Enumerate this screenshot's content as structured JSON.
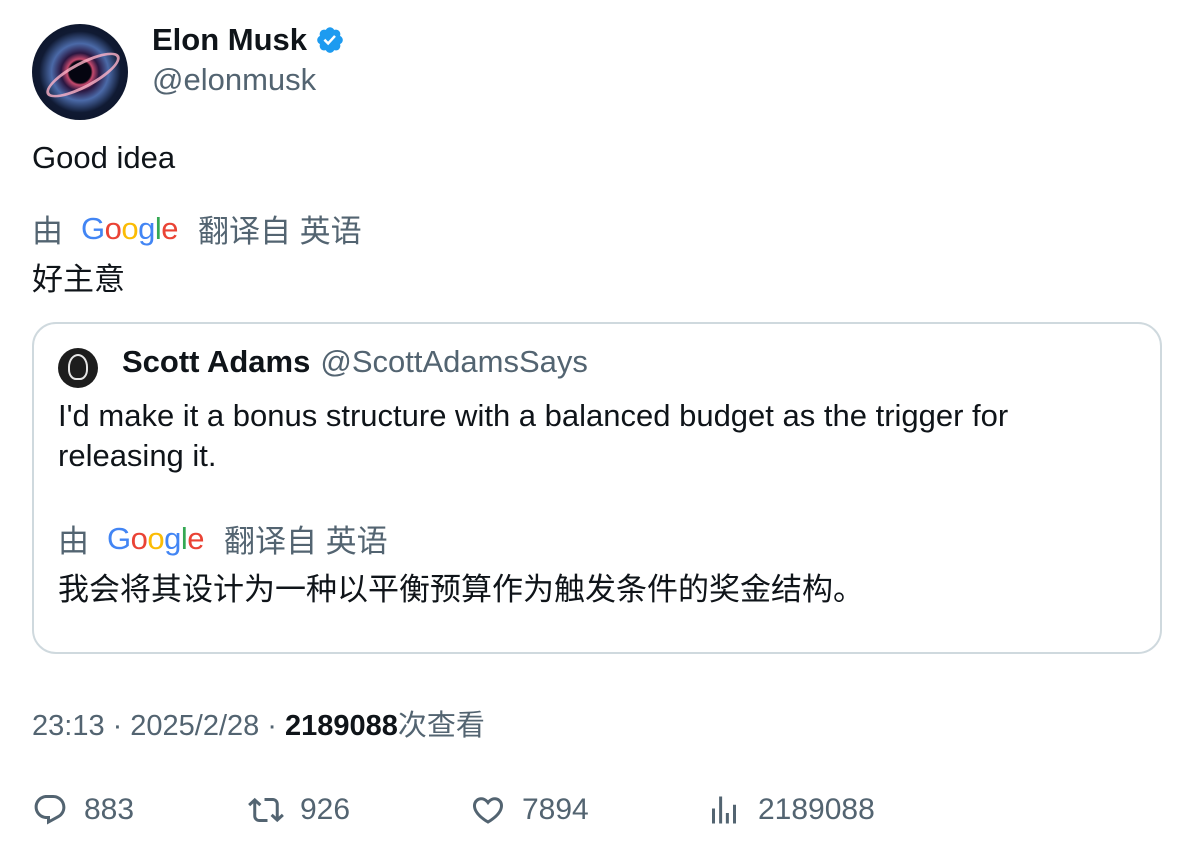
{
  "tweet": {
    "author": {
      "name": "Elon Musk",
      "handle": "@elonmusk",
      "verified_color": "#1d9bf0"
    },
    "text": "Good idea",
    "translation": {
      "by": "由",
      "provider": "Google",
      "from": "翻译自 英语",
      "text": "好主意"
    }
  },
  "quote": {
    "author": {
      "name": "Scott Adams",
      "handle": "@ScottAdamsSays"
    },
    "text": "I'd make it a bonus structure with a balanced budget as the trigger for releasing it.",
    "translation": {
      "by": "由",
      "provider": "Google",
      "from": "翻译自 英语",
      "text": "我会将其设计为一种以平衡预算作为触发条件的奖金结构。"
    }
  },
  "meta": {
    "time": "23:13",
    "sep": "·",
    "date": "2025/2/28",
    "views": "2189088",
    "views_label": "次查看"
  },
  "actions": {
    "replies": {
      "icon": "reply-icon",
      "count": "883"
    },
    "reposts": {
      "icon": "repost-icon",
      "count": "926"
    },
    "likes": {
      "icon": "like-icon",
      "count": "7894"
    },
    "views": {
      "icon": "views-icon",
      "count": "2189088"
    }
  }
}
